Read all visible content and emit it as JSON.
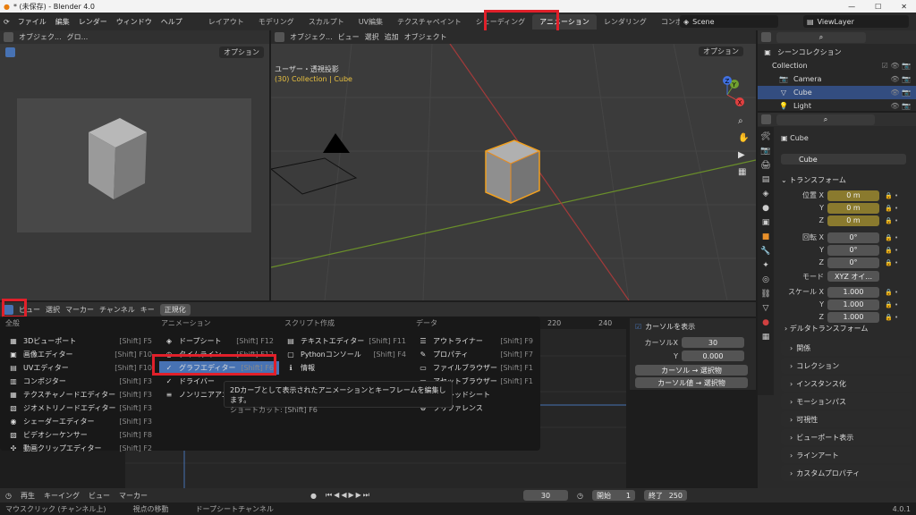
{
  "titlebar": {
    "title": "* (未保存) - Blender 4.0"
  },
  "menu": {
    "items": [
      "ファイル",
      "編集",
      "レンダー",
      "ウィンドウ",
      "ヘルプ"
    ]
  },
  "workspaces": [
    "レイアウト",
    "モデリング",
    "スカルプト",
    "UV編集",
    "テクスチャペイント",
    "シェーディング",
    "アニメーション",
    "レンダリング",
    "コンポジティング"
  ],
  "active_workspace": "アニメーション",
  "scene": {
    "name": "Scene",
    "view_layer": "ViewLayer"
  },
  "camera_view": {
    "header_label": "オブジェク...",
    "header_label2": "グロ...",
    "options": "オプション"
  },
  "viewport": {
    "header": [
      "オブジェク...",
      "ビュー",
      "選択",
      "追加",
      "オブジェクト"
    ],
    "options": "オプション",
    "view_name": "ユーザー・透視投影",
    "collection_info": "(30) Collection | Cube",
    "gizmo": {
      "x": "X",
      "y": "Y",
      "z": "Z"
    }
  },
  "outliner": {
    "title": "シーンコレクション",
    "collection": "Collection",
    "items": [
      "Camera",
      "Cube",
      "Light"
    ]
  },
  "properties": {
    "object_name": "Cube",
    "object_field": "Cube",
    "transform_title": "トランスフォーム",
    "location_label": "位置 X",
    "loc": [
      {
        "axis": "位置 X",
        "value": "0 m"
      },
      {
        "axis": "Y",
        "value": "0 m"
      },
      {
        "axis": "Z",
        "value": "0 m"
      }
    ],
    "rot": [
      {
        "axis": "回転 X",
        "value": "0°"
      },
      {
        "axis": "Y",
        "value": "0°"
      },
      {
        "axis": "Z",
        "value": "0°"
      }
    ],
    "mode_label": "モード",
    "mode_value": "XYZ オイ...",
    "scale": [
      {
        "axis": "スケール X",
        "value": "1.000"
      },
      {
        "axis": "Y",
        "value": "1.000"
      },
      {
        "axis": "Z",
        "value": "1.000"
      }
    ],
    "delta": "デルタトランスフォーム",
    "sections": [
      "関係",
      "コレクション",
      "インスタンス化",
      "モーションパス",
      "可視性",
      "ビューポート表示",
      "ラインアート",
      "カスタムプロパティ"
    ]
  },
  "dopesheet": {
    "menus": [
      "ビュー",
      "選択",
      "マーカー",
      "チャンネル",
      "キー"
    ],
    "normalize": "正規化",
    "ticks": [
      "220",
      "240"
    ],
    "sidebar": {
      "show_cursor": "カーソルを表示",
      "cursor_x_label": "カーソルX",
      "cursor_x": "30",
      "y_label": "Y",
      "y_value": "0.000",
      "btn1": "カーソル → 選択物",
      "btn2": "カーソル値 → 選択物"
    }
  },
  "editor_menu": {
    "col_general_title": "全般",
    "general": [
      {
        "label": "3Dビューポート",
        "shortcut": "[Shift] F5",
        "icon": "▦"
      },
      {
        "label": "画像エディター",
        "shortcut": "[Shift] F10",
        "icon": "▣"
      },
      {
        "label": "UVエディター",
        "shortcut": "[Shift] F10",
        "icon": "▤"
      },
      {
        "label": "コンポジター",
        "shortcut": "[Shift] F3",
        "icon": "▥"
      },
      {
        "label": "テクスチャノードエディター",
        "shortcut": "[Shift] F3",
        "icon": "▦"
      },
      {
        "label": "ジオメトリノードエディター",
        "shortcut": "[Shift] F3",
        "icon": "▧"
      },
      {
        "label": "シェーダーエディター",
        "shortcut": "[Shift] F3",
        "icon": "◉"
      },
      {
        "label": "ビデオシーケンサー",
        "shortcut": "[Shift] F8",
        "icon": "▨"
      },
      {
        "label": "動画クリップエディター",
        "shortcut": "[Shift] F2",
        "icon": "✣"
      }
    ],
    "col_anim_title": "アニメーション",
    "animation": [
      {
        "label": "ドープシート",
        "shortcut": "[Shift] F12",
        "icon": "◈"
      },
      {
        "label": "タイムライン",
        "shortcut": "[Shift] F12",
        "icon": "◷"
      },
      {
        "label": "グラフエディター",
        "shortcut": "[Shift] F6",
        "icon": "✓"
      },
      {
        "label": "ドライバー",
        "shortcut": "",
        "icon": "✓"
      },
      {
        "label": "ノンリニアアニ",
        "shortcut": "",
        "icon": "≡"
      }
    ],
    "col_script_title": "スクリプト作成",
    "script": [
      {
        "label": "テキストエディター",
        "shortcut": "[Shift] F11",
        "icon": "▤"
      },
      {
        "label": "Pythonコンソール",
        "shortcut": "[Shift] F4",
        "icon": "▢"
      },
      {
        "label": "情報",
        "shortcut": "",
        "icon": "ℹ"
      }
    ],
    "col_data_title": "データ",
    "data": [
      {
        "label": "アウトライナー",
        "shortcut": "[Shift] F9",
        "icon": "☰"
      },
      {
        "label": "プロパティ",
        "shortcut": "[Shift] F7",
        "icon": "✎"
      },
      {
        "label": "ファイルブラウザー",
        "shortcut": "[Shift] F1",
        "icon": "▭"
      },
      {
        "label": "アセットブラウザー",
        "shortcut": "[Shift] F1",
        "icon": "▭"
      },
      {
        "label": "スプレッドシート",
        "shortcut": "",
        "icon": "▦"
      },
      {
        "label": "プリファレンス",
        "shortcut": "",
        "icon": "⚙"
      }
    ],
    "tooltip_line1": "2Dカーブとして表示されたアニメーションとキーフレームを編集します。",
    "tooltip_line2": "ショートカット: [Shift] F6"
  },
  "timeline": {
    "items": [
      "再生",
      "キーイング",
      "ビュー",
      "マーカー"
    ],
    "current_frame": "30",
    "start_label": "開始",
    "start": "1",
    "end_label": "終了",
    "end": "250"
  },
  "statusbar": {
    "items": [
      "マウスクリック (チャンネル上)",
      "視点の移動",
      "ドープシートチャンネル"
    ],
    "version": "4.0.1"
  }
}
